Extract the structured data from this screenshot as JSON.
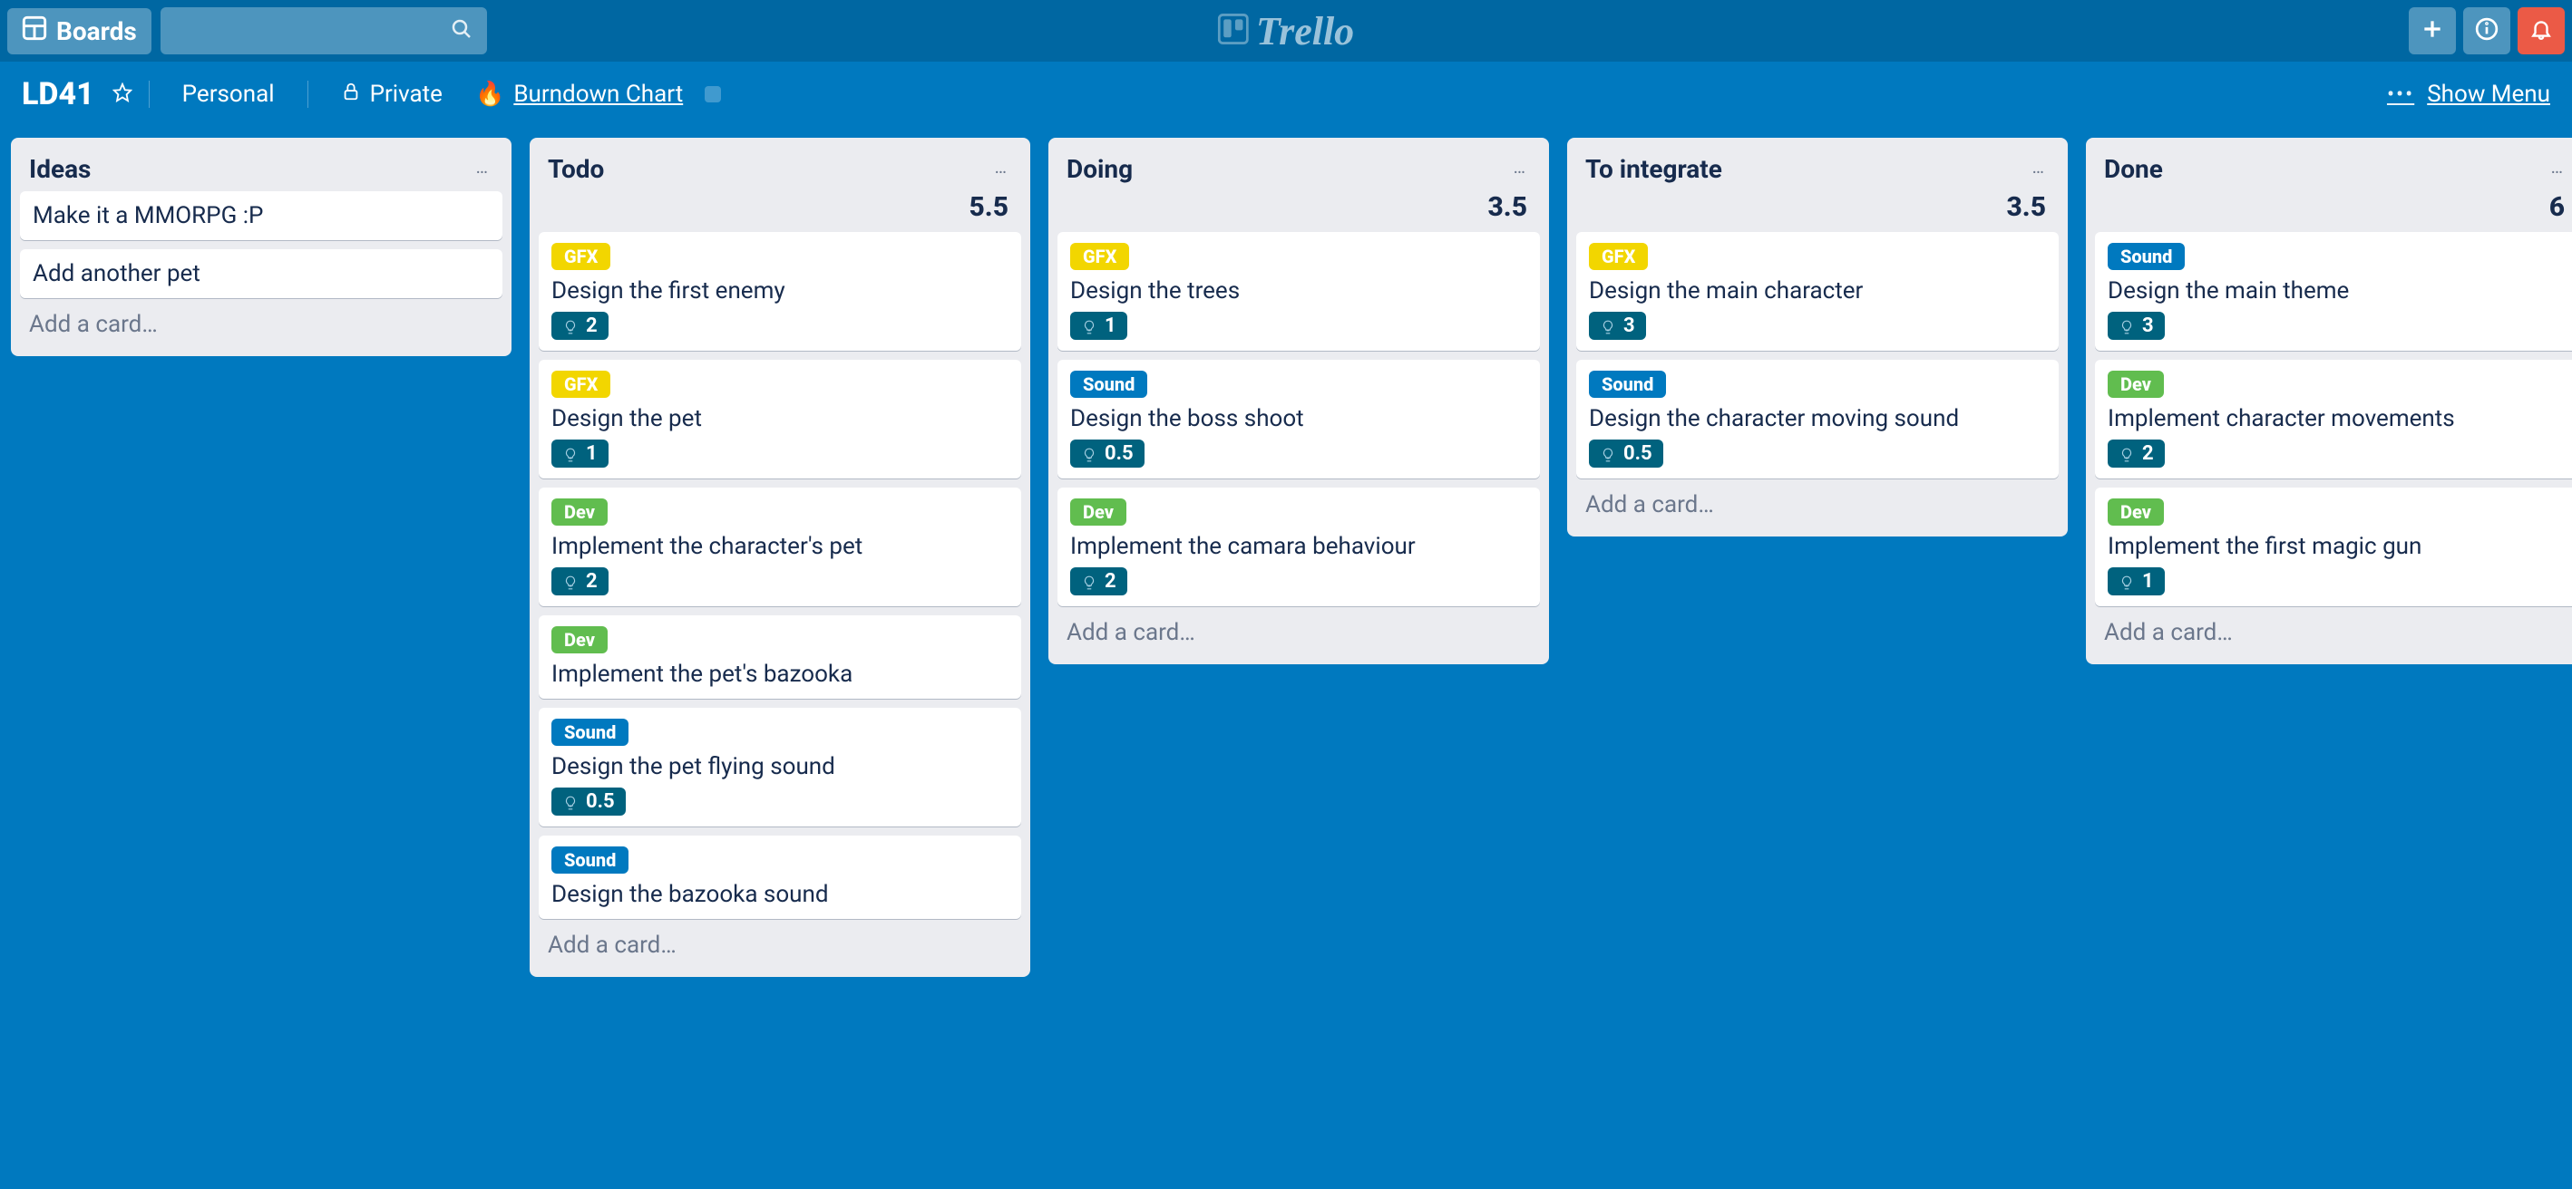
{
  "header": {
    "boards_label": "Boards",
    "logo_text": "Trello"
  },
  "board_bar": {
    "board_name": "LD41",
    "team": "Personal",
    "visibility": "Private",
    "powerup_label": "Burndown Chart",
    "show_menu_label": "Show Menu"
  },
  "labels": {
    "gfx": "GFX",
    "dev": "Dev",
    "sound": "Sound"
  },
  "add_card_label": "Add a card…",
  "lists": [
    {
      "title": "Ideas",
      "total": "",
      "cards": [
        {
          "label": null,
          "title": "Make it a MMORPG :P",
          "points": null
        },
        {
          "label": null,
          "title": "Add another pet",
          "points": null
        }
      ]
    },
    {
      "title": "Todo",
      "total": "5.5",
      "cards": [
        {
          "label": "gfx",
          "title": "Design the first enemy",
          "points": "2"
        },
        {
          "label": "gfx",
          "title": "Design the pet",
          "points": "1"
        },
        {
          "label": "dev",
          "title": "Implement the character's pet",
          "points": "2"
        },
        {
          "label": "dev",
          "title": "Implement the pet's bazooka",
          "points": null
        },
        {
          "label": "sound",
          "title": "Design the pet flying sound",
          "points": "0.5"
        },
        {
          "label": "sound",
          "title": "Design the bazooka sound",
          "points": null
        }
      ]
    },
    {
      "title": "Doing",
      "total": "3.5",
      "cards": [
        {
          "label": "gfx",
          "title": "Design the trees",
          "points": "1"
        },
        {
          "label": "sound",
          "title": "Design the boss shoot",
          "points": "0.5"
        },
        {
          "label": "dev",
          "title": "Implement the camara behaviour",
          "points": "2"
        }
      ]
    },
    {
      "title": "To integrate",
      "total": "3.5",
      "cards": [
        {
          "label": "gfx",
          "title": "Design the main character",
          "points": "3"
        },
        {
          "label": "sound",
          "title": "Design the character moving sound",
          "points": "0.5"
        }
      ]
    },
    {
      "title": "Done",
      "total": "6",
      "cards": [
        {
          "label": "sound",
          "title": "Design the main theme",
          "points": "3"
        },
        {
          "label": "dev",
          "title": "Implement character movements",
          "points": "2"
        },
        {
          "label": "dev",
          "title": "Implement the first magic gun",
          "points": "1"
        }
      ]
    }
  ]
}
